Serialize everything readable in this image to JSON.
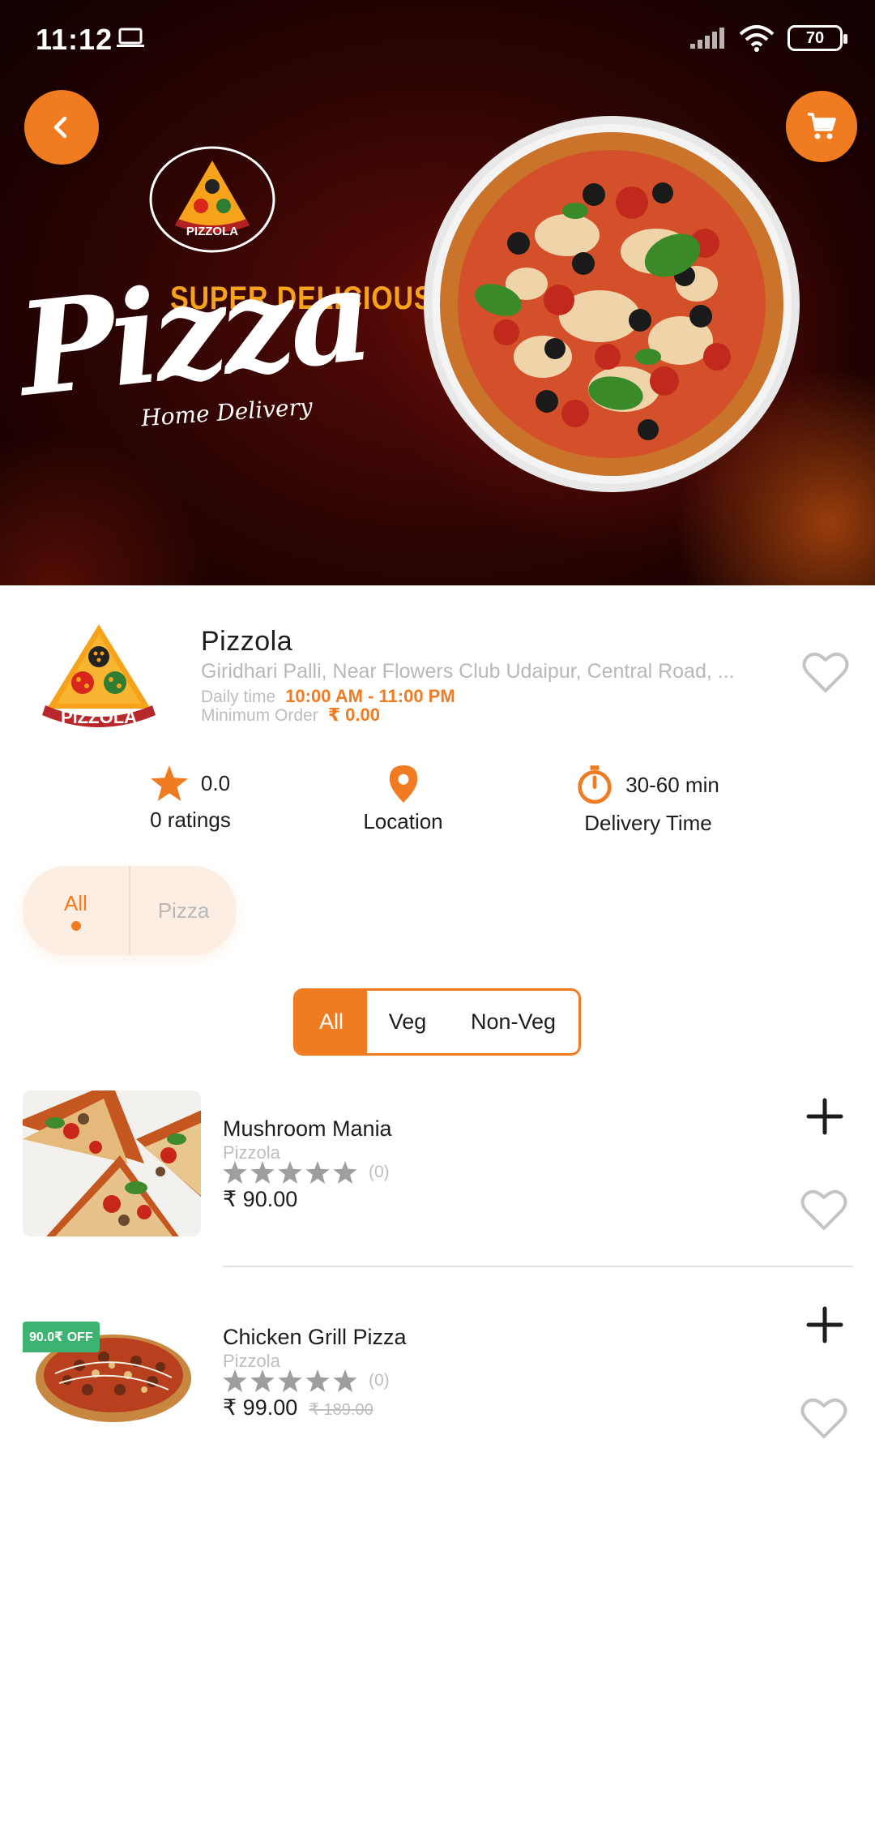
{
  "status_bar": {
    "time": "11:12",
    "battery": "70"
  },
  "hero": {
    "brand_badge": "PIZZOLA",
    "tagline": "SUPER DELICIOUS",
    "headline": "Pizza",
    "subline": "Home Delivery"
  },
  "restaurant": {
    "logo_text": "PIZZOLA",
    "name": "Pizzola",
    "address": "Giridhari Palli, Near Flowers Club Udaipur, Central Road, ...",
    "daily_time_label": "Daily time",
    "daily_time_value": "10:00 AM - 11:00 PM",
    "min_order_label": "Minimum Order",
    "min_order_value": "₹ 0.00"
  },
  "stats": {
    "rating_value": "0.0",
    "rating_label": "0 ratings",
    "location_label": "Location",
    "delivery_value": "30-60 min",
    "delivery_label": "Delivery Time"
  },
  "categories": [
    {
      "label": "All",
      "active": true
    },
    {
      "label": "Pizza",
      "active": false
    }
  ],
  "diet_filter": [
    {
      "label": "All",
      "active": true
    },
    {
      "label": "Veg",
      "active": false
    },
    {
      "label": "Non-Veg",
      "active": false
    }
  ],
  "products": [
    {
      "name": "Mushroom Mania",
      "restaurant": "Pizzola",
      "rating_count": "(0)",
      "rating": 0,
      "price": "₹ 90.00",
      "old_price": "",
      "badge": ""
    },
    {
      "name": "Chicken Grill Pizza",
      "restaurant": "Pizzola",
      "rating_count": "(0)",
      "rating": 0,
      "price": "₹ 99.00",
      "old_price": "₹ 189.00",
      "badge": "90.0₹ OFF"
    }
  ],
  "colors": {
    "accent": "#f07b20",
    "badge_green": "#3cb371",
    "muted": "#bdbdbd"
  },
  "icons": [
    "back-arrow-icon",
    "cart-icon",
    "heart-icon",
    "star-icon",
    "location-pin-icon",
    "timer-icon",
    "plus-icon",
    "wifi-icon",
    "signal-icon",
    "laptop-icon"
  ]
}
